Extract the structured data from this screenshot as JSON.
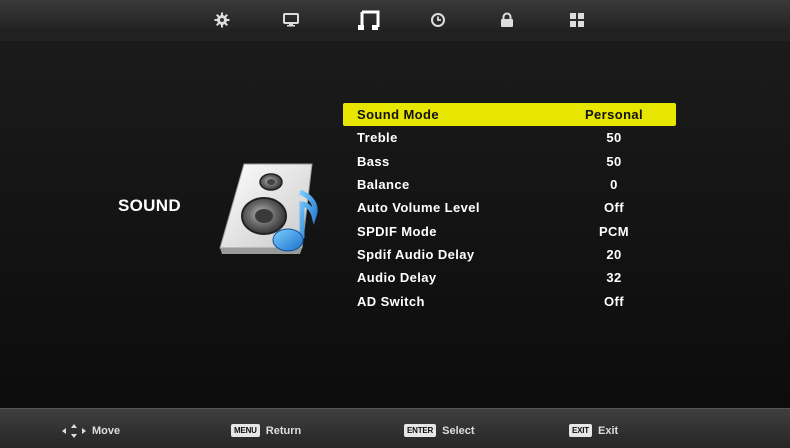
{
  "screen": {
    "title": "SOUND",
    "accent_color": "#e6e600"
  },
  "tabs": [
    {
      "name": "picture",
      "icon": "gear-icon",
      "selected": false
    },
    {
      "name": "screen",
      "icon": "monitor-icon",
      "selected": false
    },
    {
      "name": "sound",
      "icon": "music-note-icon",
      "selected": true
    },
    {
      "name": "time",
      "icon": "clock-icon",
      "selected": false
    },
    {
      "name": "lock",
      "icon": "lock-icon",
      "selected": false
    },
    {
      "name": "setup",
      "icon": "grid-icon",
      "selected": false
    }
  ],
  "menu": {
    "items": [
      {
        "label": "Sound Mode",
        "value": "Personal",
        "selected": true
      },
      {
        "label": "Treble",
        "value": "50"
      },
      {
        "label": "Bass",
        "value": "50"
      },
      {
        "label": "Balance",
        "value": "0"
      },
      {
        "label": "Auto Volume Level",
        "value": "Off"
      },
      {
        "label": "SPDIF Mode",
        "value": "PCM"
      },
      {
        "label": "Spdif Audio Delay",
        "value": "20"
      },
      {
        "label": "Audio Delay",
        "value": "32"
      },
      {
        "label": "AD Switch",
        "value": "Off"
      }
    ]
  },
  "footer": {
    "move": "Move",
    "menu_key": "MENU",
    "return": "Return",
    "enter_key": "ENTER",
    "select": "Select",
    "exit_key": "EXIT",
    "exit": "Exit"
  }
}
